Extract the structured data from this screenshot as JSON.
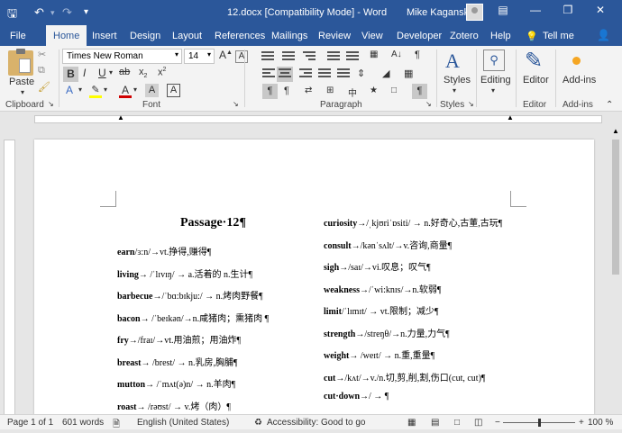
{
  "window": {
    "title": "12.docx [Compatibility Mode]  -  Word",
    "user": "Mike Kaganski",
    "controls": [
      "ribbon-display-icon",
      "minimize-icon",
      "restore-icon",
      "close-icon"
    ]
  },
  "tabs": [
    "File",
    "Home",
    "Insert",
    "Design",
    "Layout",
    "References",
    "Mailings",
    "Review",
    "View",
    "Developer",
    "Zotero",
    "Help"
  ],
  "tell_me": "Tell me",
  "ribbon": {
    "paste": "Paste",
    "font_name": "Times New Roman",
    "font_size": "14",
    "styles": "Styles",
    "editing": "Editing",
    "editor": "Editor",
    "addins": "Add-ins",
    "groups": [
      "Clipboard",
      "Font",
      "Paragraph",
      "Styles",
      "Editor",
      "Add-ins"
    ]
  },
  "document": {
    "title": "Passage·12¶",
    "left": [
      {
        "word": "earn",
        "rest": "/ɜ:n/→vt.挣得,赚得¶"
      },
      {
        "word": "living",
        "rest": "→ /ˈlɪvɪŋ/ → a.活着的 n.生计¶"
      },
      {
        "word": "barbecue",
        "rest": "→/ˈbɑ:bɪkju:/ → n.烤肉野餐¶"
      },
      {
        "word": "bacon",
        "rest": "→ /ˈbeɪkən/→n.咸猪肉；熏猪肉   ¶"
      },
      {
        "word": "fry",
        "rest": "→/fraɪ/→vt.用油煎；用油炸¶"
      },
      {
        "word": "breast",
        "rest": "→ /brest/ → n.乳房,胸脯¶"
      },
      {
        "word": "mutton",
        "rest": "→ /ˈmʌt(ə)n/  →  n.羊肉¶"
      },
      {
        "word": "roast",
        "rest": "→ /rəʊst/ → v.烤（肉）¶"
      }
    ],
    "right": [
      {
        "word": "curiosity",
        "rest": "→/ˌkjʊriˈɒsiti/ → n.好奇心,古董,古玩¶"
      },
      {
        "word": "consult",
        "rest": "→/kənˈsʌlt/→v.咨询,商量¶"
      },
      {
        "word": "sigh",
        "rest": "→/saɪ/→vi.叹息；叹气¶"
      },
      {
        "word": "weakness",
        "rest": "→/ˈwi:knɪs/→n.软弱¶"
      },
      {
        "word": "limit",
        "rest": "/ˈlɪmɪt/ → vt.限制；减少¶"
      },
      {
        "word": "strength",
        "rest": "→/streŋθ/→n.力量,力气¶"
      },
      {
        "word": "weight",
        "rest": "→ /weɪt/  →  n.重,重量¶"
      },
      {
        "word": "cut",
        "rest": "→/kʌt/→v./n.切,剪,削,割,伤口(cut, cut)¶"
      },
      {
        "word": "cut·down",
        "rest": "→/  → ¶"
      }
    ]
  },
  "status": {
    "page": "Page 1 of 1",
    "words": "601 words",
    "language": "English (United States)",
    "accessibility": "Accessibility: Good to go",
    "zoom": "100 %",
    "zoom_level": 1.0
  },
  "colors": {
    "accent": "#2b579a",
    "ribbon": "#f3f3f3",
    "highlight": "#ffff00",
    "font_color": "#d00000"
  }
}
